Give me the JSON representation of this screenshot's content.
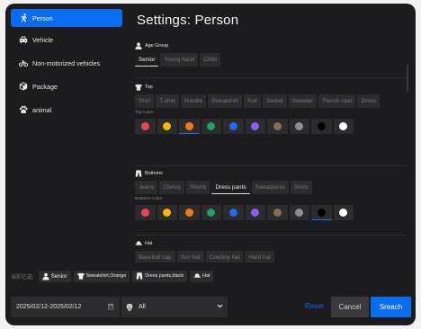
{
  "sidebar": {
    "items": [
      {
        "label": "Person",
        "icon": "running-person-icon",
        "active": true
      },
      {
        "label": "Vehicle",
        "icon": "car-icon",
        "active": false
      },
      {
        "label": "Non-motorized vehicles",
        "icon": "bicycle-icon",
        "active": false
      },
      {
        "label": "Package",
        "icon": "package-icon",
        "active": false
      },
      {
        "label": "animal",
        "icon": "paw-icon",
        "active": false
      }
    ]
  },
  "page": {
    "title": "Settings: Person"
  },
  "sections": {
    "age": {
      "title": "Age Group",
      "icon": "person-icon",
      "options": [
        "Senior",
        "Young Adult",
        "Child"
      ],
      "selected": "Senior"
    },
    "top": {
      "title": "Top",
      "icon": "shirt-icon",
      "options": [
        "Shirt",
        "T-shirt",
        "Hoodie",
        "Sweatshirt",
        "Suit",
        "Jacket",
        "Sweater",
        "Trench coat",
        "Dress"
      ],
      "selected": "Sweatshirt",
      "color_label": "Top Color",
      "selected_color": 2
    },
    "bottoms": {
      "title": "Bottoms",
      "icon": "pants-icon",
      "options": [
        "Jeans",
        "Chinos",
        "Shorts",
        "Dress pants",
        "Sweatpants",
        "Skirts"
      ],
      "selected": "Dress pants",
      "color_label": "Bottoms Color",
      "selected_color": 8
    },
    "hat": {
      "title": "Hat",
      "icon": "hat-icon",
      "options": [
        "Baseball cap",
        "Sun hat",
        "Cowboy hat",
        "Hard hat"
      ],
      "selected": ""
    }
  },
  "colors": [
    {
      "name": "red",
      "hex": "#e5484d"
    },
    {
      "name": "yellow",
      "hex": "#f5b700"
    },
    {
      "name": "orange",
      "hex": "#f07a10"
    },
    {
      "name": "green",
      "hex": "#1fa463"
    },
    {
      "name": "blue",
      "hex": "#1e6cf0"
    },
    {
      "name": "purple",
      "hex": "#8b5cf6"
    },
    {
      "name": "brown",
      "hex": "#8a6a55"
    },
    {
      "name": "gray",
      "hex": "#8e8e93"
    },
    {
      "name": "black",
      "hex": "#000000"
    },
    {
      "name": "white",
      "hex": "#ffffff"
    }
  ],
  "selected_bar": {
    "label": "当前已选:",
    "tags": [
      {
        "label": "Senior",
        "icon": "person-icon"
      },
      {
        "label": "Sweatshirt,Orange",
        "icon": "shirt-icon"
      },
      {
        "label": "Dress pants,black",
        "icon": "pants-icon"
      },
      {
        "label": "Hat",
        "icon": "hat-icon"
      }
    ]
  },
  "bottom": {
    "date_range": "2025/02/12-2025/02/12",
    "camera_select": "All",
    "reset_label": "Reset",
    "cancel_label": "Cancel",
    "search_label": "Sreach"
  },
  "accent_color": "#0a6cf0"
}
